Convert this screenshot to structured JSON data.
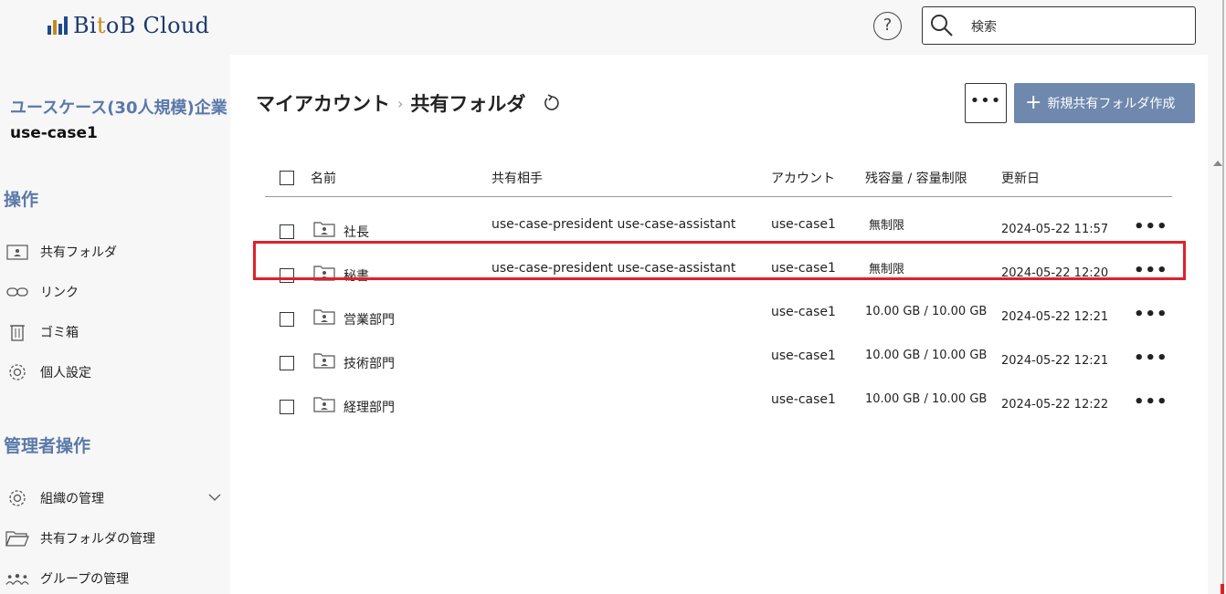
{
  "app": {
    "logo_text_pre": "Bi",
    "logo_text_t": "t",
    "logo_text_post": "oB Cloud"
  },
  "header": {
    "help_label": "?",
    "search_placeholder": "検索"
  },
  "sidebar": {
    "company_name": "ユースケース(30人規模)企業",
    "account_name": "use-case1",
    "section_ops": "操作",
    "ops_items": [
      {
        "label": "共有フォルダ",
        "icon": "shared-folder-icon"
      },
      {
        "label": "リンク",
        "icon": "link-icon"
      },
      {
        "label": "ゴミ箱",
        "icon": "trash-icon"
      },
      {
        "label": "個人設定",
        "icon": "gear-icon"
      }
    ],
    "section_admin": "管理者操作",
    "admin_items": [
      {
        "label": "組織の管理",
        "icon": "gear-icon"
      },
      {
        "label": "共有フォルダの管理",
        "icon": "folder-open-icon"
      },
      {
        "label": "グループの管理",
        "icon": "group-icon"
      }
    ]
  },
  "main": {
    "breadcrumb_root": "マイアカウント",
    "breadcrumb_sep": "›",
    "breadcrumb_current": "共有フォルダ",
    "more_label": "•••",
    "new_button_plus": "+",
    "new_button_label": "新規共有フォルダ作成",
    "columns": {
      "name": "名前",
      "shared_with": "共有相手",
      "account": "アカウント",
      "quota": "残容量 / 容量制限",
      "updated": "更新日"
    },
    "rows": [
      {
        "name": "社長",
        "shared_with": "use-case-president  use-case-assistant",
        "account": "use-case1",
        "quota": "無制限",
        "updated": "2024-05-22 11:57",
        "more": "•••"
      },
      {
        "name": "秘書",
        "shared_with": "use-case-president  use-case-assistant",
        "account": "use-case1",
        "quota": "無制限",
        "updated": "2024-05-22 12:20",
        "more": "•••"
      },
      {
        "name": "営業部門",
        "shared_with": "",
        "account": "use-case1",
        "quota": "10.00 GB / 10.00 GB",
        "updated": "2024-05-22 12:21",
        "more": "•••"
      },
      {
        "name": "技術部門",
        "shared_with": "",
        "account": "use-case1",
        "quota": "10.00 GB / 10.00 GB",
        "updated": "2024-05-22 12:21",
        "more": "•••"
      },
      {
        "name": "経理部門",
        "shared_with": "",
        "account": "use-case1",
        "quota": "10.00 GB / 10.00 GB",
        "updated": "2024-05-22 12:22",
        "more": "•••"
      }
    ]
  },
  "colors": {
    "accent": "#5a79a8",
    "primary_button": "#6f88ad",
    "highlight": "#e0202a"
  }
}
